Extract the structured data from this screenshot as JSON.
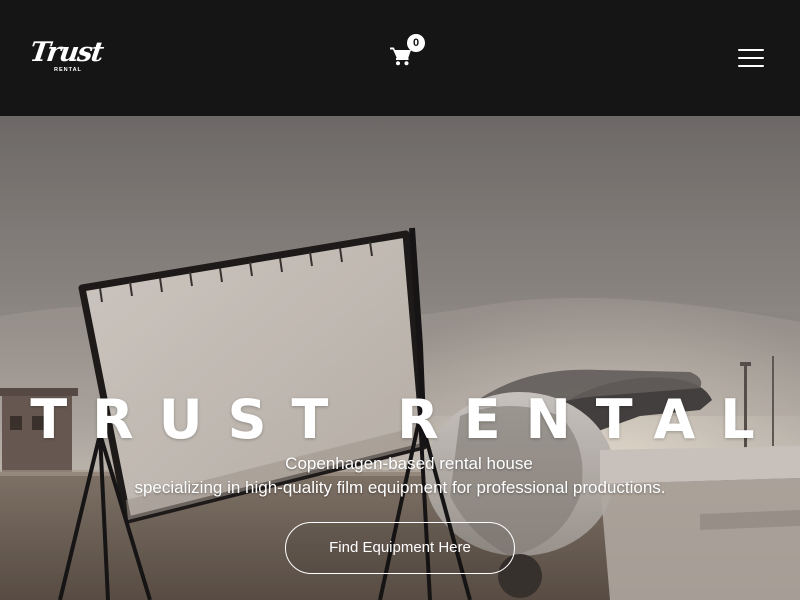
{
  "header": {
    "logo": {
      "script": "Trust",
      "sub": "RENTAL"
    },
    "cart": {
      "count": "0",
      "icon": "cart-icon"
    },
    "menu_icon": "hamburger-menu-icon"
  },
  "hero": {
    "title": "TRUST RENTAL",
    "tagline_line1": "Copenhagen-based rental house",
    "tagline_line2": "specializing in high-quality film equipment for professional productions.",
    "cta_label": "Find Equipment Here"
  },
  "colors": {
    "header_bg": "#161516",
    "text": "#ffffff",
    "sky_top": "#7c7977",
    "sky_bottom": "#cfc9c2"
  }
}
